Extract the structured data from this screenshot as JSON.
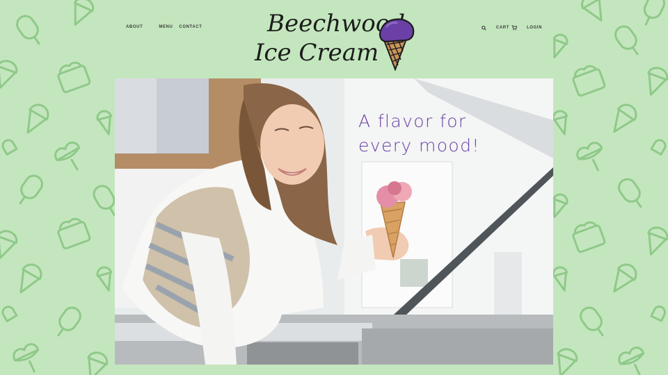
{
  "nav": {
    "left": [
      {
        "label": "ABOUT"
      },
      {
        "label": "MENU"
      },
      {
        "label": "CONTACT"
      }
    ],
    "cart_label": "CART",
    "login_label": "LOGIN"
  },
  "logo": {
    "line1": "Beechwood",
    "line2": "Ice Cream"
  },
  "hero": {
    "headline": "A flavor for\nevery mood!"
  },
  "colors": {
    "background": "#c4e6be",
    "accent_purple": "#6a40a6",
    "pattern_stroke": "#8fc989",
    "cone": "#c9955a"
  },
  "icons": [
    "search-icon",
    "cart-icon",
    "ice-cream-cone-icon",
    "popsicle-icon",
    "sundae-icon"
  ]
}
